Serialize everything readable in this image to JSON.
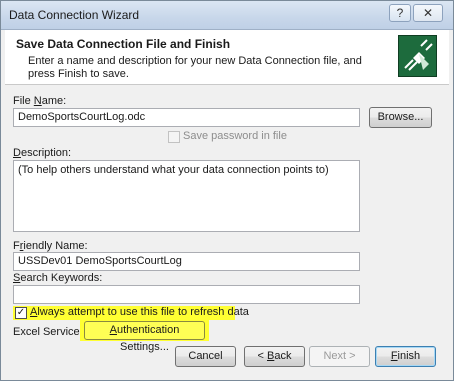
{
  "window": {
    "title": "Data Connection Wizard",
    "help_glyph": "?",
    "close_glyph": "✕"
  },
  "header": {
    "title": "Save Data Connection File and Finish",
    "description": "Enter a name and description for your new Data Connection file, and press Finish to save.",
    "icon": "data-connection-wizard-icon"
  },
  "file_name": {
    "label_u": "N",
    "label_rest": "ame:",
    "label_prefix": "File ",
    "value": "DemoSportsCourtLog.odc",
    "browse_label": "Browse..."
  },
  "save_password": {
    "label": "Save password in file",
    "checked": false,
    "enabled": false
  },
  "description": {
    "label_u": "D",
    "label_rest": "escription:",
    "value": "(To help others understand what your data connection points to)"
  },
  "friendly_name": {
    "label_prefix": "F",
    "label_u": "r",
    "label_rest": "iendly Name:",
    "value": "USSDev01 DemoSportsCourtLog"
  },
  "search_keywords": {
    "label_u": "S",
    "label_rest": "earch Keywords:",
    "value": ""
  },
  "refresh_option": {
    "label_u": "A",
    "label_rest": "lways attempt to use this file to refresh data",
    "checked": true
  },
  "excel_services": {
    "label": "Excel Services:",
    "button_label_u": "A",
    "button_label_rest": "uthentication Settings..."
  },
  "footer": {
    "cancel_label": "Cancel",
    "back_label_prefix": "< ",
    "back_label_u": "B",
    "back_label_rest": "ack",
    "next_label": "Next >",
    "finish_label_u": "F",
    "finish_label_rest": "inish"
  },
  "colors": {
    "highlight": "#ffff33",
    "title_bar": "#c8d7ea",
    "wizard_icon_bg": "#1d6b3d"
  }
}
